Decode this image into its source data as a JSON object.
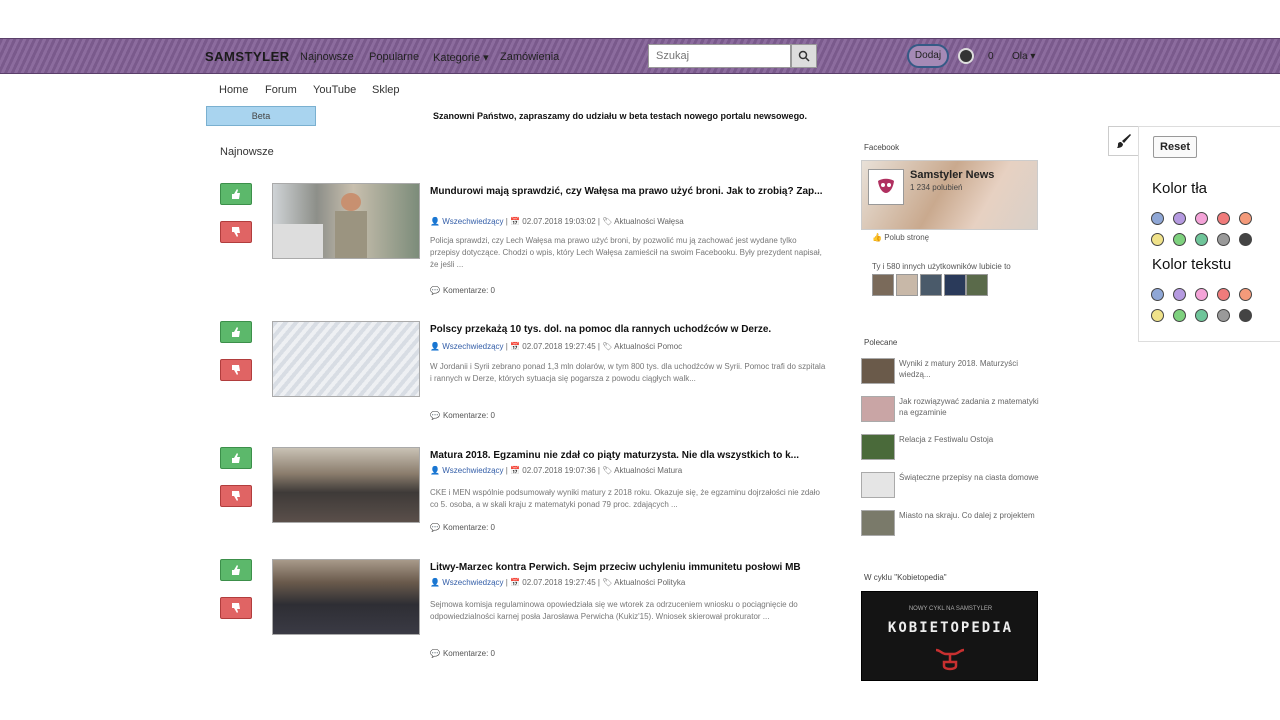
{
  "navbar": {
    "brand": "SAMSTYLER",
    "links": [
      "Najnowsze",
      "Popularne",
      "Kategorie ▾",
      "Zamówienia"
    ],
    "search_placeholder": "Szukaj",
    "pill_label": "Dodaj",
    "count": "0",
    "user_menu": "Ola ▾"
  },
  "subnav": [
    "Home",
    "Forum",
    "YouTube",
    "Sklep"
  ],
  "blue_button": "Beta",
  "announcement": "Szanowni Państwo, zapraszamy do udziału w beta testach nowego portalu newsowego.",
  "section_title": "Najnowsze",
  "articles": [
    {
      "title": "Mundurowi mają sprawdzić, czy Wałęsa ma prawo użyć broni. Jak to zrobią? Zap...",
      "author": "Wszechwiedzący",
      "date": "02.07.2018 19:03:02",
      "tags": "Aktualności Wałęsa",
      "excerpt": "Policja sprawdzi, czy Lech Wałęsa ma prawo użyć broni, by pozwolić mu ją zachować jest wydane tylko przepisy dotyczące. Chodzi o wpis, który Lech Wałęsa zamieścił na swoim Facebooku. Były prezydent napisał, że jeśli ...",
      "comments": "Komentarze: 0"
    },
    {
      "title": "Polscy przekażą 10 tys. dol. na pomoc dla rannych uchodźców w Derze.",
      "author": "Wszechwiedzący",
      "date": "02.07.2018 19:27:45",
      "tags": "Aktualności Pomoc",
      "excerpt": "W Jordanii i Syrii zebrano ponad 1,3 mln dolarów, w tym 800 tys. dla uchodźców w Syrii. Pomoc trafi do szpitala i rannych w Derze, których sytuacja się pogarsza z powodu ciągłych walk...",
      "comments": "Komentarze: 0"
    },
    {
      "title": "Matura 2018. Egzaminu nie zdał co piąty maturzysta. Nie dla wszystkich to k...",
      "author": "Wszechwiedzący",
      "date": "02.07.2018 19:07:36",
      "tags": "Aktualności Matura",
      "excerpt": "CKE i MEN wspólnie podsumowały wyniki matury z 2018 roku. Okazuje się, że egzaminu dojrzałości nie zdało co 5. osoba, a w skali kraju z matematyki ponad 79 proc. zdających ...",
      "comments": "Komentarze: 0"
    },
    {
      "title": "Litwy-Marzec kontra Perwich. Sejm przeciw uchyleniu immunitetu posłowi MB",
      "author": "Wszechwiedzący",
      "date": "02.07.2018 19:27:45",
      "tags": "Aktualności Polityka",
      "excerpt": "Sejmowa komisja regulaminowa opowiedziała się we wtorek za odrzuceniem wniosku o pociągnięcie do odpowiedzialności karnej posła Jarosława Perwicha (Kukiz'15). Wniosek skierował prokurator ...",
      "comments": "Komentarze: 0"
    }
  ],
  "facebook": {
    "heading": "Facebook",
    "page_name": "Samstyler News",
    "page_sub": "1 234 polubień",
    "like_label": "Polub stronę",
    "count_text": "Ty i 580 innych użytkowników lubicie to"
  },
  "popular": {
    "heading": "Polecane",
    "items": [
      "Wyniki z matury 2018. Maturzyści wiedzą...",
      "Jak rozwiązywać zadania z matematyki na egzaminie",
      "Relacja z Festiwalu Ostoja",
      "Świąteczne przepisy na ciasta domowe",
      "Miasto na skraju. Co dalej z projektem"
    ]
  },
  "promo": {
    "heading": "W cyklu \"Kobietopedia\"",
    "small": "NOWY CYKL NA SAMSTYLER",
    "title": "KOBIETOPEDIA"
  },
  "color_panel": {
    "reset": "Reset",
    "bg_heading": "Kolor tła",
    "text_heading": "Kolor tekstu",
    "swatches": [
      "#8fa7d6",
      "#b59ae0",
      "#f4a3d8",
      "#f07b7b",
      "#f49a7a",
      "#f0e28a",
      "#7ed17e",
      "#6fc59a",
      "#9a9a9a",
      "#444444"
    ]
  },
  "colors": {
    "up": "#5cb86b",
    "down": "#e06464",
    "accent": "#7a5a8c",
    "link": "#335ea8"
  }
}
